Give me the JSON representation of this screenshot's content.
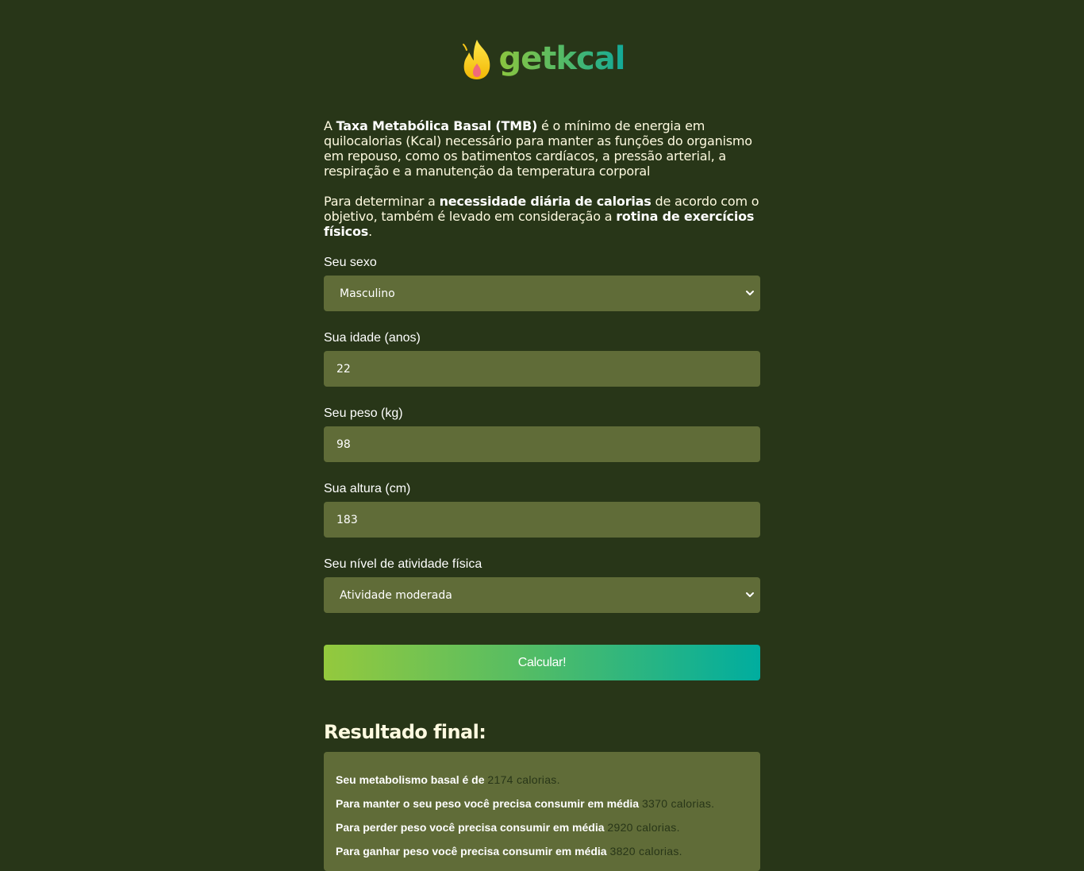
{
  "brand": {
    "name": "getkcal",
    "icon": "flame-icon"
  },
  "intro": {
    "p1_pre": "A ",
    "p1_bold": "Taxa Metabólica Basal (TMB)",
    "p1_post": " é o mínimo de energia em quilocalorias (Kcal) necessário para manter as funções do organismo em repouso, como os batimentos cardíacos, a pressão arterial, a respiração e a manutenção da temperatura corporal",
    "p2_pre": "Para determinar a ",
    "p2_bold1": "necessidade diária de calorias",
    "p2_mid": " de acordo com o objetivo, também é levado em consideração a ",
    "p2_bold2": "rotina de exercícios físicos",
    "p2_post": "."
  },
  "form": {
    "sex": {
      "label": "Seu sexo",
      "value": "Masculino"
    },
    "age": {
      "label": "Sua idade (anos)",
      "value": "22"
    },
    "weight": {
      "label": "Seu peso (kg)",
      "value": "98"
    },
    "height": {
      "label": "Sua altura (cm)",
      "value": "183"
    },
    "activity": {
      "label": "Seu nível de atividade física",
      "value": "Atividade moderada"
    },
    "submit_label": "Calcular!"
  },
  "result": {
    "title": "Resultado final:",
    "lines": [
      {
        "text": "Seu metabolismo basal é de ",
        "value": "2174 calorias."
      },
      {
        "text": "Para manter o seu peso você precisa consumir em média ",
        "value": "3370 calorias."
      },
      {
        "text": "Para perder peso você precisa consumir em média ",
        "value": "2920 calorias."
      },
      {
        "text": "Para ganhar peso você precisa consumir em média ",
        "value": "3820 calorias."
      }
    ]
  },
  "colors": {
    "background": "#283618",
    "field": "#606c38",
    "accent_start": "#94c93d",
    "accent_end": "#00ad9f"
  }
}
